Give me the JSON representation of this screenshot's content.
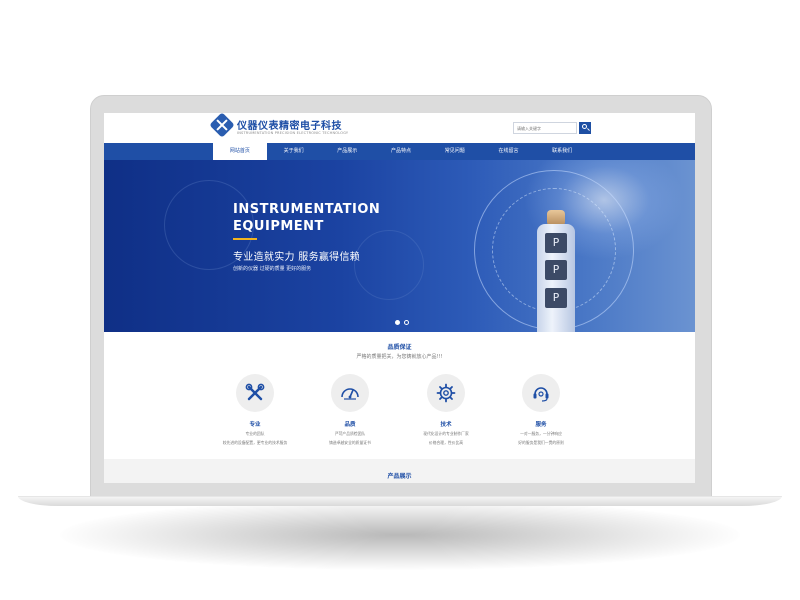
{
  "header": {
    "logo_title": "仪器仪表精密电子科技",
    "logo_sub": "INSTRUMENTATION PRECISION ELECTRONIC TECHNOLOGY",
    "search_placeholder": "请输入关键字"
  },
  "nav": {
    "items": [
      {
        "label": "网站首页",
        "active": true
      },
      {
        "label": "关于我们"
      },
      {
        "label": "产品展示"
      },
      {
        "label": "产品特点"
      },
      {
        "label": "常见问题"
      },
      {
        "label": "在线留言"
      },
      {
        "label": "联系我们"
      }
    ]
  },
  "banner": {
    "title_line1": "INSTRUMENTATION",
    "title_line2": "EQUIPMENT",
    "cn_title": "专业造就实力  服务赢得信赖",
    "cn_sub": "创新的仪器  过硬的质量  更好的服务",
    "button_glyph": "P",
    "accent_color": "#f2b41f"
  },
  "quality": {
    "title": "品质保证",
    "subtitle": "严格的质量把关，为您铸就放心产品!!!",
    "features": [
      {
        "icon": "tools-icon",
        "title": "专业",
        "desc1": "专业的团队",
        "desc2": "较先进的设备配置，更专业的技术服务"
      },
      {
        "icon": "gauge-icon",
        "title": "品质",
        "desc1": "严苛产品质检团队",
        "desc2": "铸造卓越安全的质量证书"
      },
      {
        "icon": "gear-icon",
        "title": "技术",
        "desc1": "现代化设计的专业制作厂家",
        "desc2": "价格合理，性价比高"
      },
      {
        "icon": "service-icon",
        "title": "服务",
        "desc1": "一对一服务，一分钟响应",
        "desc2": "好的服务是我们一贯的原则"
      }
    ]
  },
  "products": {
    "title": "产品展示"
  },
  "colors": {
    "brand": "#1f4fa6",
    "accent": "#f2b41f"
  }
}
